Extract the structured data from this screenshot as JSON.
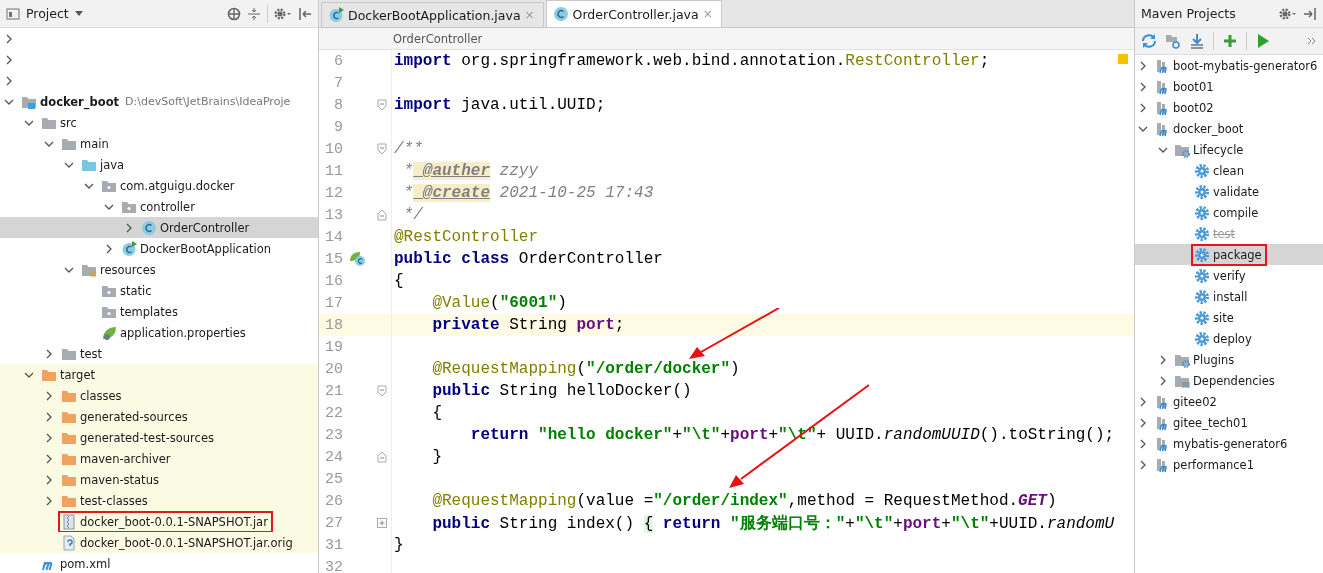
{
  "project_panel": {
    "title": "Project",
    "tree": [
      {
        "expanded": false,
        "selected": false,
        "marked": false
      },
      {
        "expanded": false,
        "selected": false,
        "marked": false
      },
      {
        "expanded": false,
        "selected": false,
        "marked": false
      },
      {
        "label": "docker_boot",
        "path": "D:\\devSoft\\JetBrains\\IdeaProje",
        "kind": "module",
        "expanded": true,
        "selected": false,
        "marked": false,
        "children": [
          {
            "label": "src",
            "kind": "folder",
            "expanded": true,
            "selected": false,
            "marked": false,
            "children": [
              {
                "label": "main",
                "kind": "folder",
                "expanded": true,
                "selected": false,
                "marked": false,
                "children": [
                  {
                    "label": "java",
                    "kind": "sourcefolder",
                    "expanded": true,
                    "selected": false,
                    "marked": false,
                    "children": [
                      {
                        "label": "com.atguigu.docker",
                        "kind": "package",
                        "expanded": true,
                        "selected": false,
                        "marked": false,
                        "children": [
                          {
                            "label": "controller",
                            "kind": "package",
                            "expanded": true,
                            "selected": false,
                            "marked": false,
                            "children": [
                              {
                                "label": "OrderController",
                                "kind": "class",
                                "expanded": false,
                                "selected": true,
                                "marked": false
                              }
                            ]
                          },
                          {
                            "label": "DockerBootApplication",
                            "kind": "appclass",
                            "expanded": false,
                            "selected": false,
                            "marked": false
                          }
                        ]
                      }
                    ]
                  },
                  {
                    "label": "resources",
                    "kind": "resources",
                    "expanded": true,
                    "selected": false,
                    "marked": false,
                    "children": [
                      {
                        "label": "static",
                        "kind": "package",
                        "selected": false,
                        "marked": false
                      },
                      {
                        "label": "templates",
                        "kind": "package",
                        "selected": false,
                        "marked": false
                      },
                      {
                        "label": "application.properties",
                        "kind": "spring",
                        "selected": false,
                        "marked": false
                      }
                    ]
                  }
                ]
              },
              {
                "label": "test",
                "kind": "folder",
                "expanded": false,
                "selected": false,
                "marked": false
              }
            ]
          },
          {
            "label": "target",
            "kind": "excludedfolder",
            "excluded": true,
            "expanded": true,
            "selected": false,
            "marked": false,
            "children": [
              {
                "label": "classes",
                "kind": "excludedfolder",
                "expanded": false,
                "selected": false,
                "marked": false
              },
              {
                "label": "generated-sources",
                "kind": "excludedfolder",
                "expanded": false,
                "selected": false,
                "marked": false
              },
              {
                "label": "generated-test-sources",
                "kind": "excludedfolder",
                "expanded": false,
                "selected": false,
                "marked": false
              },
              {
                "label": "maven-archiver",
                "kind": "excludedfolder",
                "expanded": false,
                "selected": false,
                "marked": false
              },
              {
                "label": "maven-status",
                "kind": "excludedfolder",
                "expanded": false,
                "selected": false,
                "marked": false
              },
              {
                "label": "test-classes",
                "kind": "excludedfolder",
                "expanded": false,
                "selected": false,
                "marked": false
              },
              {
                "label": "docker_boot-0.0.1-SNAPSHOT.jar",
                "kind": "jar",
                "selected": false,
                "marked": true
              },
              {
                "label": "docker_boot-0.0.1-SNAPSHOT.jar.orig",
                "kind": "unknownfile",
                "selected": false,
                "marked": false
              }
            ]
          },
          {
            "label": "pom.xml",
            "kind": "mavenfile",
            "selected": false,
            "marked": false
          }
        ]
      }
    ]
  },
  "editor": {
    "tabs": [
      {
        "label": "DockerBootApplication.java",
        "kind": "appclass",
        "close": "×",
        "selected": false
      },
      {
        "label": "OrderController.java",
        "kind": "class",
        "close": "×",
        "selected": true
      }
    ],
    "breadcrumb": "OrderController",
    "lines": [
      {
        "num": "6",
        "kind": "plain",
        "current": false,
        "tokens": [
          {
            "kind": "kw",
            "text": "import"
          },
          {
            "kind": "plain",
            "text": " org.springframework.web.bind.annotation."
          },
          {
            "kind": "ann",
            "text": "RestController"
          },
          {
            "kind": "plain",
            "text": ";"
          }
        ]
      },
      {
        "num": "7",
        "kind": "plain",
        "current": false
      },
      {
        "num": "8",
        "kind": "foldstart",
        "current": false,
        "tokens": [
          {
            "kind": "kw",
            "text": "import"
          },
          {
            "kind": "plain",
            "text": " java.util.UUID;"
          }
        ]
      },
      {
        "num": "9",
        "kind": "plain",
        "current": false
      },
      {
        "num": "10",
        "kind": "foldstart",
        "current": false,
        "tokens": [
          {
            "kind": "comment",
            "text": "/**"
          }
        ]
      },
      {
        "num": "11",
        "kind": "plain",
        "current": false,
        "tokens": [
          {
            "kind": "comment",
            "text": " *"
          },
          {
            "kind": "doctag",
            "text": " @auther"
          },
          {
            "kind": "comment",
            "text": " zzyy"
          }
        ]
      },
      {
        "num": "12",
        "kind": "plain",
        "current": false,
        "tokens": [
          {
            "kind": "comment",
            "text": " *"
          },
          {
            "kind": "doctag",
            "text": " @create"
          },
          {
            "kind": "comment",
            "text": " 2021-10-25 17:43"
          }
        ]
      },
      {
        "num": "13",
        "kind": "foldend",
        "current": false,
        "tokens": [
          {
            "kind": "comment",
            "text": " */"
          }
        ]
      },
      {
        "num": "14",
        "kind": "plain",
        "current": false,
        "tokens": [
          {
            "kind": "ann",
            "text": "@RestController"
          }
        ]
      },
      {
        "num": "15",
        "kind": "bean",
        "current": false,
        "tokens": [
          {
            "kind": "kw",
            "text": "public class"
          },
          {
            "kind": "plain",
            "text": " OrderController"
          }
        ]
      },
      {
        "num": "16",
        "kind": "plain",
        "current": false,
        "tokens": [
          {
            "kind": "plain",
            "text": "{"
          }
        ]
      },
      {
        "num": "17",
        "kind": "plain",
        "current": false,
        "tokens": [
          {
            "kind": "ann",
            "text": "    @Value"
          },
          {
            "kind": "plain",
            "text": "("
          },
          {
            "kind": "str",
            "text": "\"6001\""
          },
          {
            "kind": "plain",
            "text": ")"
          }
        ]
      },
      {
        "num": "18",
        "kind": "plain",
        "current": true,
        "tokens": [
          {
            "kind": "kw",
            "text": "    private"
          },
          {
            "kind": "plain",
            "text": " String "
          },
          {
            "kind": "field",
            "text": "port"
          },
          {
            "kind": "plain",
            "text": ";"
          }
        ]
      },
      {
        "num": "19",
        "kind": "plain",
        "current": false
      },
      {
        "num": "20",
        "kind": "plain",
        "current": false,
        "tokens": [
          {
            "kind": "ann",
            "text": "    @RequestMapping"
          },
          {
            "kind": "plain",
            "text": "("
          },
          {
            "kind": "str",
            "text": "\"/order/docker\""
          },
          {
            "kind": "plain",
            "text": ")"
          }
        ]
      },
      {
        "num": "21",
        "kind": "foldstart",
        "current": false,
        "tokens": [
          {
            "kind": "kw",
            "text": "    public"
          },
          {
            "kind": "plain",
            "text": " String helloDocker()"
          }
        ]
      },
      {
        "num": "22",
        "kind": "plain",
        "current": false,
        "tokens": [
          {
            "kind": "plain",
            "text": "    {"
          }
        ]
      },
      {
        "num": "23",
        "kind": "plain",
        "current": false,
        "tokens": [
          {
            "kind": "kw",
            "text": "        return"
          },
          {
            "kind": "str",
            "text": " \"hello docker\""
          },
          {
            "kind": "plain",
            "text": "+"
          },
          {
            "kind": "str",
            "text": "\"\\t\""
          },
          {
            "kind": "plain",
            "text": "+"
          },
          {
            "kind": "field",
            "text": "port"
          },
          {
            "kind": "plain",
            "text": "+"
          },
          {
            "kind": "str",
            "text": "\"\\t\""
          },
          {
            "kind": "plain",
            "text": "+ UUID."
          },
          {
            "kind": "static",
            "text": "randomUUID"
          },
          {
            "kind": "plain",
            "text": "().toString();"
          }
        ]
      },
      {
        "num": "24",
        "kind": "foldend",
        "current": false,
        "tokens": [
          {
            "kind": "plain",
            "text": "    }"
          }
        ]
      },
      {
        "num": "25",
        "kind": "plain",
        "current": false
      },
      {
        "num": "26",
        "kind": "plain",
        "current": false,
        "tokens": [
          {
            "kind": "ann",
            "text": "    @RequestMapping"
          },
          {
            "kind": "plain",
            "text": "(value ="
          },
          {
            "kind": "str",
            "text": "\"/order/index\""
          },
          {
            "kind": "plain",
            "text": ",method = RequestMethod."
          },
          {
            "kind": "const",
            "text": "GET"
          },
          {
            "kind": "plain",
            "text": ")"
          }
        ]
      },
      {
        "num": "27",
        "kind": "folded",
        "current": false,
        "tokens": [
          {
            "kind": "kw",
            "text": "    public"
          },
          {
            "kind": "plain",
            "text": " String index() "
          },
          {
            "kind": "folded",
            "text": "{"
          },
          {
            "kind": "kw",
            "text": " return"
          },
          {
            "kind": "str",
            "text": " \"服务端口号：\""
          },
          {
            "kind": "plain",
            "text": "+"
          },
          {
            "kind": "str",
            "text": "\"\\t\""
          },
          {
            "kind": "plain",
            "text": "+"
          },
          {
            "kind": "field",
            "text": "port"
          },
          {
            "kind": "plain",
            "text": "+"
          },
          {
            "kind": "str",
            "text": "\"\\t\""
          },
          {
            "kind": "plain",
            "text": "+UUID."
          },
          {
            "kind": "static",
            "text": "randomU"
          }
        ]
      },
      {
        "num": "31",
        "kind": "plain",
        "current": false,
        "tokens": [
          {
            "kind": "plain",
            "text": "}"
          }
        ]
      },
      {
        "num": "32",
        "kind": "plain",
        "current": false
      }
    ]
  },
  "maven_panel": {
    "title": "Maven Projects",
    "tree": [
      {
        "label": "boot-mybatis-generator6",
        "kind": "mavenmodule",
        "expanded": false,
        "selected": false,
        "marked": false
      },
      {
        "label": "boot01",
        "kind": "mavenmodule",
        "expanded": false,
        "selected": false,
        "marked": false
      },
      {
        "label": "boot02",
        "kind": "mavenmodule",
        "expanded": false,
        "selected": false,
        "marked": false
      },
      {
        "label": "docker_boot",
        "kind": "mavenmodule",
        "expanded": true,
        "selected": false,
        "marked": false,
        "children": [
          {
            "label": "Lifecycle",
            "kind": "lifecycle",
            "expanded": true,
            "selected": false,
            "marked": false,
            "children": [
              {
                "label": "clean",
                "kind": "goal",
                "skipped": false,
                "selected": false,
                "marked": false
              },
              {
                "label": "validate",
                "kind": "goal",
                "skipped": false,
                "selected": false,
                "marked": false
              },
              {
                "label": "compile",
                "kind": "goal",
                "skipped": false,
                "selected": false,
                "marked": false
              },
              {
                "label": "test",
                "kind": "goal",
                "skipped": true,
                "selected": false,
                "marked": false
              },
              {
                "label": "package",
                "kind": "goal",
                "skipped": false,
                "selected": true,
                "marked": true
              },
              {
                "label": "verify",
                "kind": "goal",
                "skipped": false,
                "selected": false,
                "marked": false
              },
              {
                "label": "install",
                "kind": "goal",
                "skipped": false,
                "selected": false,
                "marked": false
              },
              {
                "label": "site",
                "kind": "goal",
                "skipped": false,
                "selected": false,
                "marked": false
              },
              {
                "label": "deploy",
                "kind": "goal",
                "skipped": false,
                "selected": false,
                "marked": false
              }
            ]
          },
          {
            "label": "Plugins",
            "kind": "lifecycle",
            "expanded": false,
            "selected": false,
            "marked": false
          },
          {
            "label": "Dependencies",
            "kind": "dependencies",
            "expanded": false,
            "selected": false,
            "marked": false
          }
        ]
      },
      {
        "label": "gitee02",
        "kind": "mavenmodule",
        "expanded": false,
        "selected": false,
        "marked": false
      },
      {
        "label": "gitee_tech01",
        "kind": "mavenmodule",
        "expanded": false,
        "selected": false,
        "marked": false
      },
      {
        "label": "mybatis-generator6",
        "kind": "mavenmodule",
        "expanded": false,
        "selected": false,
        "marked": false
      },
      {
        "label": "performance1",
        "kind": "mavenmodule",
        "expanded": false,
        "selected": false,
        "marked": false
      }
    ]
  }
}
